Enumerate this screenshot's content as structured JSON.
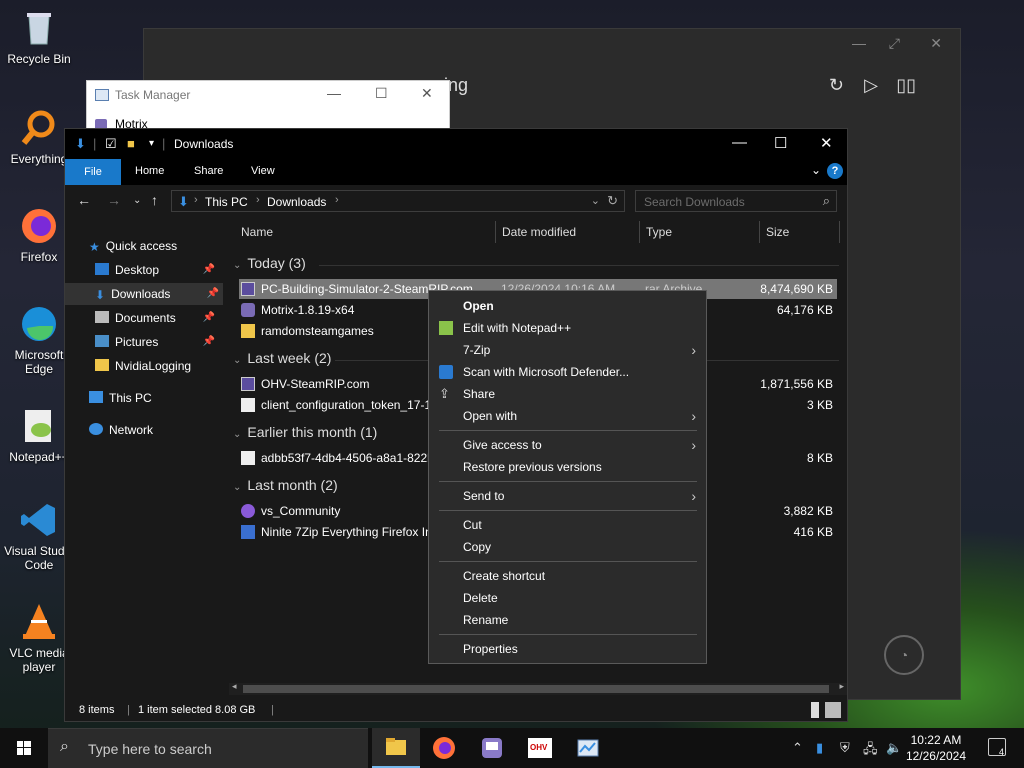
{
  "desktop": {
    "icons": [
      {
        "label": "Recycle Bin",
        "icon": "recycle-bin-icon"
      },
      {
        "label": "Everything",
        "icon": "everything-search-icon"
      },
      {
        "label": "Firefox",
        "icon": "firefox-icon"
      },
      {
        "label": "Microsoft Edge",
        "icon": "edge-icon"
      },
      {
        "label": "Notepad++",
        "icon": "notepadpp-icon"
      },
      {
        "label": "Visual Studio Code",
        "icon": "vscode-icon"
      },
      {
        "label": "VLC media player",
        "icon": "vlc-icon"
      }
    ]
  },
  "bg_app": {
    "title_fragment": "ing"
  },
  "task_manager": {
    "title": "Task Manager",
    "row": "Motrix"
  },
  "explorer": {
    "title": "Downloads",
    "ribbon": {
      "file": "File",
      "home": "Home",
      "share": "Share",
      "view": "View"
    },
    "address": {
      "crumbs": [
        "This PC",
        "Downloads"
      ]
    },
    "search_placeholder": "Search Downloads",
    "nav": {
      "quick_access": "Quick access",
      "items": [
        {
          "label": "Desktop",
          "pinned": true
        },
        {
          "label": "Downloads",
          "pinned": true
        },
        {
          "label": "Documents",
          "pinned": true
        },
        {
          "label": "Pictures",
          "pinned": true
        },
        {
          "label": "NvidiaLogging",
          "pinned": false
        }
      ],
      "this_pc": "This PC",
      "network": "Network"
    },
    "columns": {
      "name": "Name",
      "date": "Date modified",
      "type": "Type",
      "size": "Size"
    },
    "groups": [
      {
        "title": "Today (3)",
        "files": [
          {
            "name": "PC-Building-Simulator-2-SteamRIP.com",
            "date": "12/26/2024 10:16 AM",
            "type": "rar Archive",
            "size": "8,474,690 KB",
            "selected": true
          },
          {
            "name": "Motrix-1.8.19-x64",
            "date": "",
            "type": "",
            "size": "64,176 KB"
          },
          {
            "name": "ramdomsteamgames",
            "date": "",
            "type": "",
            "size": ""
          }
        ]
      },
      {
        "title": "Last week (2)",
        "files": [
          {
            "name": "OHV-SteamRIP.com",
            "date": "",
            "type": "",
            "size": "1,871,556 KB"
          },
          {
            "name": "client_configuration_token_17-1",
            "date": "",
            "type": "",
            "size": "3 KB"
          }
        ]
      },
      {
        "title": "Earlier this month (1)",
        "files": [
          {
            "name": "adbb53f7-4db4-4506-a8a1-822b",
            "date": "",
            "type": "",
            "size": "8 KB"
          }
        ]
      },
      {
        "title": "Last month (2)",
        "files": [
          {
            "name": "vs_Community",
            "date": "",
            "type": "",
            "size": "3,882 KB"
          },
          {
            "name": "Ninite 7Zip Everything Firefox In",
            "date": "",
            "type": "",
            "size": "416 KB"
          }
        ]
      }
    ],
    "status": {
      "items": "8 items",
      "selected": "1 item selected  8.08 GB"
    }
  },
  "context_menu": {
    "items": [
      {
        "label": "Open",
        "bold": true
      },
      {
        "label": "Edit with Notepad++",
        "icon": "notepadpp-icon"
      },
      {
        "label": "7-Zip",
        "submenu": true
      },
      {
        "label": "Scan with Microsoft Defender...",
        "icon": "defender-shield-icon"
      },
      {
        "label": "Share",
        "icon": "share-icon"
      },
      {
        "label": "Open with",
        "submenu": true
      },
      {
        "label": "Give access to",
        "submenu": true
      },
      {
        "label": "Restore previous versions"
      },
      {
        "label": "Send to",
        "submenu": true
      },
      {
        "label": "Cut"
      },
      {
        "label": "Copy"
      },
      {
        "label": "Create shortcut"
      },
      {
        "label": "Delete"
      },
      {
        "label": "Rename"
      },
      {
        "label": "Properties"
      }
    ]
  },
  "taskbar": {
    "search_placeholder": "Type here to search",
    "time": "10:22 AM",
    "date": "12/26/2024",
    "notifications": "4",
    "ohv_label": "OHV"
  }
}
